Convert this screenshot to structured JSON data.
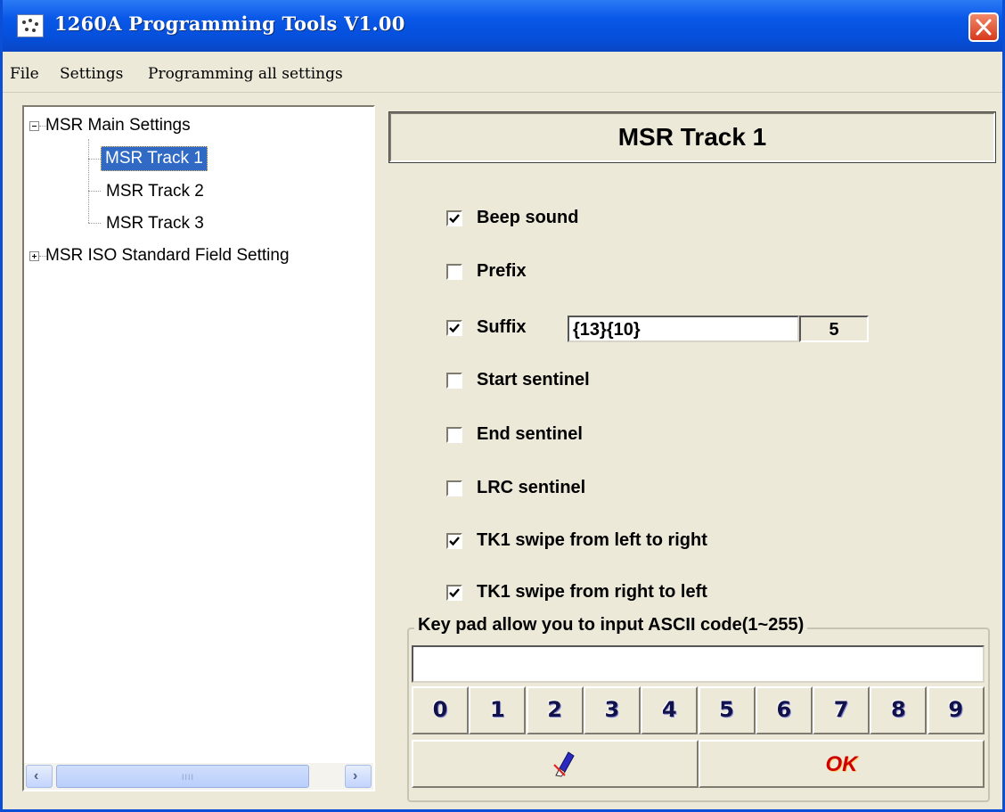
{
  "window": {
    "title": "1260A Programming Tools V1.00",
    "accent_color": "#0a58e8",
    "close_icon": "close-icon"
  },
  "menu": {
    "file": "File",
    "settings": "Settings",
    "programming": "Programming all settings"
  },
  "tree": {
    "root": "MSR Main Settings",
    "items": [
      "MSR Track 1",
      "MSR Track 2",
      "MSR Track 3"
    ],
    "selected": "MSR Track 1",
    "iso": "MSR ISO Standard Field Setting",
    "scroll_grip": "IIII"
  },
  "panel": {
    "title": "MSR Track 1",
    "options": [
      {
        "label": "Beep sound",
        "checked": true
      },
      {
        "label": "Prefix",
        "checked": false
      },
      {
        "label": "Suffix",
        "checked": true
      },
      {
        "label": "Start sentinel",
        "checked": false
      },
      {
        "label": "End sentinel",
        "checked": false
      },
      {
        "label": "LRC sentinel",
        "checked": false
      },
      {
        "label": "TK1 swipe from left to right",
        "checked": true
      },
      {
        "label": "TK1 swipe from right to left",
        "checked": true
      }
    ],
    "suffix_value": "{13}{10}",
    "suffix_count": "5"
  },
  "keypad": {
    "legend": "Key pad allow you to input ASCII code(1~255)",
    "input_value": "",
    "keys": [
      "0",
      "1",
      "2",
      "3",
      "4",
      "5",
      "6",
      "7",
      "8",
      "9"
    ],
    "erase_icon": "eraser-icon",
    "ok_label": "OK"
  }
}
